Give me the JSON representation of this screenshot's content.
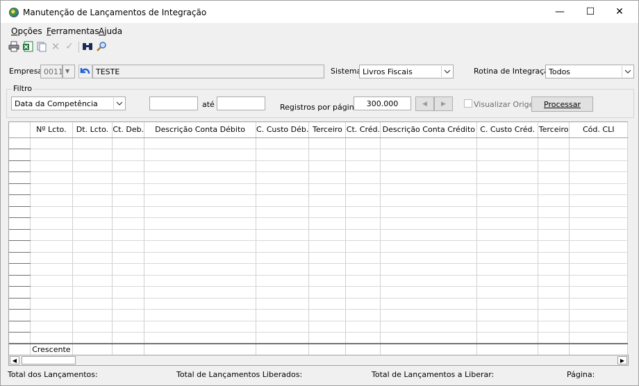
{
  "window": {
    "title": "Manutenção de Lançamentos de Integração",
    "minimize": "—",
    "maximize": "☐",
    "close": "✕"
  },
  "menu": {
    "items": [
      "Opções",
      "Ferramentas",
      "Ajuda"
    ],
    "mnemonics": [
      "O",
      "F",
      "A"
    ]
  },
  "toolbar": {
    "icons": [
      "print-icon",
      "excel-export-icon",
      "copy-icon",
      "delete-icon",
      "confirm-icon",
      "binoculars-icon",
      "search-icon"
    ]
  },
  "empresa": {
    "label": "Empresa:",
    "code": "0011",
    "name": "TESTE"
  },
  "sistema": {
    "label": "Sistema:",
    "value": "Livros Fiscais"
  },
  "rotina": {
    "label": "Rotina de Integração:",
    "value": "Todos"
  },
  "filtro": {
    "legend": "Filtro",
    "tipo_value": "Data da Competência",
    "date_from": "",
    "ate_label": "até",
    "date_to": "",
    "registros_label": "Registros por páginas:",
    "registros_value": "300.000",
    "visualizar_label": "Visualizar Origem",
    "visualizar_checked": false,
    "processar_label": "Processar"
  },
  "grid": {
    "columns": [
      "Nº Lcto.",
      "Dt. Lcto.",
      "Ct. Deb.",
      "Descrição Conta Débito",
      "C. Custo Déb.",
      "Terceiro",
      "Ct. Créd.",
      "Descrição Conta Crédito",
      "C. Custo Créd.",
      "Terceiro",
      "Cód. CLI"
    ],
    "footer_label": "Crescente",
    "empty_rows": 18
  },
  "status": {
    "total_lancamentos": "Total dos Lançamentos:",
    "total_liberados": "Total de Lançamentos Liberados:",
    "total_a_liberar": "Total de Lançamentos a Liberar:",
    "pagina": "Página:"
  },
  "colors": {
    "accent_blue": "#1e5fd6",
    "window_bg": "#f0f0f0"
  }
}
